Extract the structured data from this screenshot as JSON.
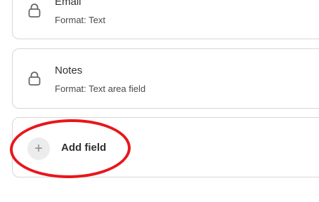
{
  "fields": [
    {
      "name": "Email",
      "format": "Format: Text",
      "icon": "lock-icon"
    },
    {
      "name": "Notes",
      "format": "Format: Text area field",
      "icon": "lock-icon"
    }
  ],
  "add_field": {
    "label": "Add field",
    "icon": "plus-icon",
    "icon_glyph": "+"
  },
  "annotation": {
    "color": "#e8161b",
    "shape": "ellipse"
  }
}
